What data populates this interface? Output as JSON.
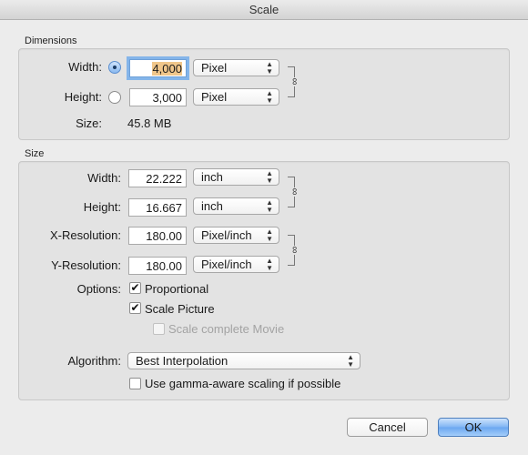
{
  "window": {
    "title": "Scale"
  },
  "dimensions": {
    "section_label": "Dimensions",
    "width_label": "Width:",
    "width_value": "4,000",
    "width_unit": "Pixel",
    "height_label": "Height:",
    "height_value": "3,000",
    "height_unit": "Pixel",
    "size_label": "Size:",
    "size_value": "45.8 MB"
  },
  "size": {
    "section_label": "Size",
    "width_label": "Width:",
    "width_value": "22.222",
    "width_unit": "inch",
    "height_label": "Height:",
    "height_value": "16.667",
    "height_unit": "inch",
    "xres_label": "X-Resolution:",
    "xres_value": "180.00",
    "xres_unit": "Pixel/inch",
    "yres_label": "Y-Resolution:",
    "yres_value": "180.00",
    "yres_unit": "Pixel/inch",
    "options_label": "Options:",
    "proportional_label": "Proportional",
    "scale_picture_label": "Scale Picture",
    "scale_movie_label": "Scale complete Movie",
    "algorithm_label": "Algorithm:",
    "algorithm_value": "Best Interpolation",
    "gamma_label": "Use gamma-aware scaling if possible"
  },
  "state": {
    "proportional": true,
    "scale_picture": true,
    "scale_movie": false,
    "gamma": false,
    "width_radio_selected": true
  },
  "buttons": {
    "cancel": "Cancel",
    "ok": "OK"
  },
  "icons": {
    "popup_arrows": "up-down-arrows-icon",
    "chain": "chain-link-icon"
  }
}
